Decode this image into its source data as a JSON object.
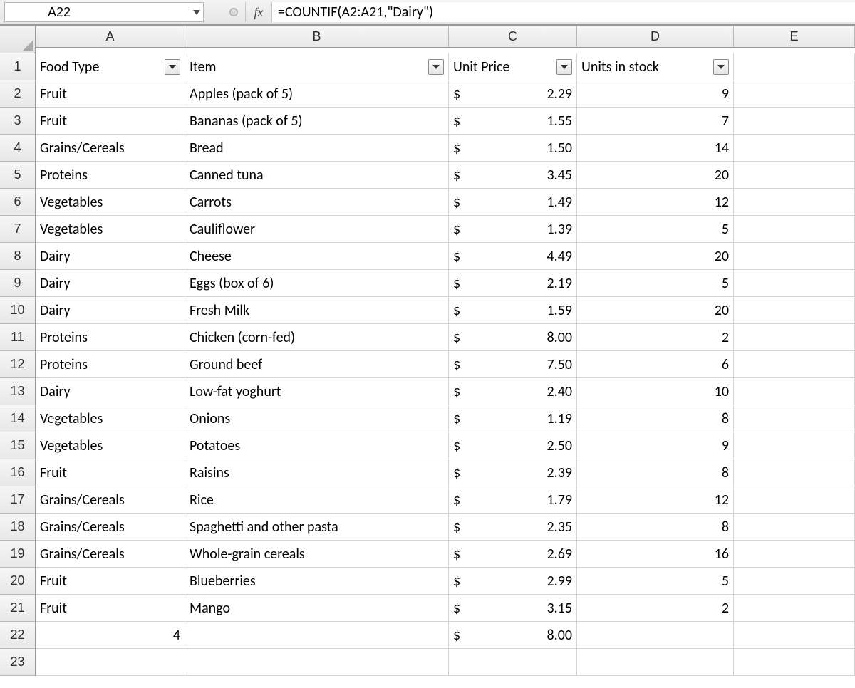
{
  "formula_bar": {
    "cell_reference": "A22",
    "fx_label": "fx",
    "formula": "=COUNTIF(A2:A21,\"Dairy\")"
  },
  "column_labels": [
    "A",
    "B",
    "C",
    "D",
    "E"
  ],
  "row_numbers": [
    1,
    2,
    3,
    4,
    5,
    6,
    7,
    8,
    9,
    10,
    11,
    12,
    13,
    14,
    15,
    16,
    17,
    18,
    19,
    20,
    21,
    22,
    23
  ],
  "headers": {
    "A": "Food Type",
    "B": "Item",
    "C": "Unit Price",
    "D": "Units in stock"
  },
  "currency_symbol": "$",
  "rows": [
    {
      "foodType": "Fruit",
      "item": "Apples (pack of 5)",
      "price": "2.29",
      "units": "9"
    },
    {
      "foodType": "Fruit",
      "item": "Bananas (pack of 5)",
      "price": "1.55",
      "units": "7"
    },
    {
      "foodType": "Grains/Cereals",
      "item": "Bread",
      "price": "1.50",
      "units": "14"
    },
    {
      "foodType": "Proteins",
      "item": "Canned tuna",
      "price": "3.45",
      "units": "20"
    },
    {
      "foodType": "Vegetables",
      "item": "Carrots",
      "price": "1.49",
      "units": "12"
    },
    {
      "foodType": "Vegetables",
      "item": "Cauliflower",
      "price": "1.39",
      "units": "5"
    },
    {
      "foodType": "Dairy",
      "item": "Cheese",
      "price": "4.49",
      "units": "20"
    },
    {
      "foodType": "Dairy",
      "item": "Eggs (box of 6)",
      "price": "2.19",
      "units": "5"
    },
    {
      "foodType": "Dairy",
      "item": "Fresh Milk",
      "price": "1.59",
      "units": "20"
    },
    {
      "foodType": "Proteins",
      "item": "Chicken (corn-fed)",
      "price": "8.00",
      "units": "2"
    },
    {
      "foodType": "Proteins",
      "item": "Ground beef",
      "price": "7.50",
      "units": "6"
    },
    {
      "foodType": "Dairy",
      "item": "Low-fat yoghurt",
      "price": "2.40",
      "units": "10"
    },
    {
      "foodType": "Vegetables",
      "item": "Onions",
      "price": "1.19",
      "units": "8"
    },
    {
      "foodType": "Vegetables",
      "item": "Potatoes",
      "price": "2.50",
      "units": "9"
    },
    {
      "foodType": "Fruit",
      "item": "Raisins",
      "price": "2.39",
      "units": "8"
    },
    {
      "foodType": "Grains/Cereals",
      "item": "Rice",
      "price": "1.79",
      "units": "12"
    },
    {
      "foodType": "Grains/Cereals",
      "item": "Spaghetti and other pasta",
      "price": "2.35",
      "units": "8"
    },
    {
      "foodType": "Grains/Cereals",
      "item": "Whole-grain cereals",
      "price": "2.69",
      "units": "16"
    },
    {
      "foodType": "Fruit",
      "item": "Blueberries",
      "price": "2.99",
      "units": "5"
    },
    {
      "foodType": "Fruit",
      "item": "Mango",
      "price": "3.15",
      "units": "2"
    }
  ],
  "row22": {
    "A": "4",
    "price": "8.00"
  }
}
